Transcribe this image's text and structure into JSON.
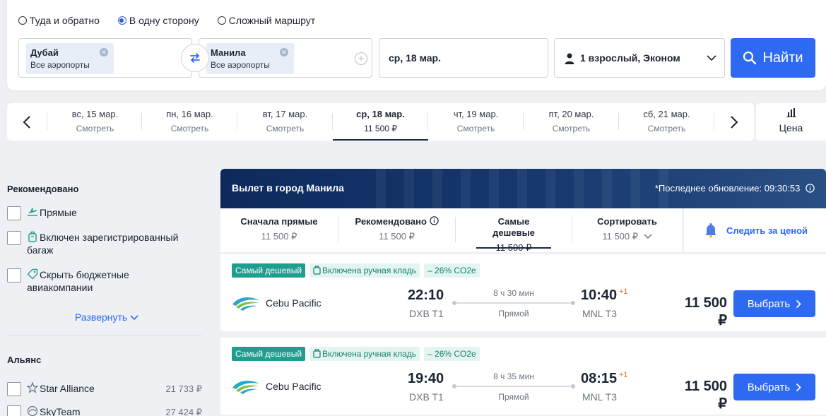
{
  "search": {
    "trip_types": [
      {
        "label": "Туда и обратно",
        "selected": false
      },
      {
        "label": "В одну сторону",
        "selected": true
      },
      {
        "label": "Сложный маршрут",
        "selected": false
      }
    ],
    "from": {
      "city": "Дубай",
      "sub": "Все аэропорты"
    },
    "to": {
      "city": "Манила",
      "sub": "Все аэропорты"
    },
    "date": "ср, 18 мар.",
    "passengers": "1 взрослый, Эконом",
    "button": "Найти"
  },
  "date_strip": {
    "days": [
      {
        "date": "вс, 15 мар.",
        "price": "Смотреть",
        "selected": false
      },
      {
        "date": "пн, 16 мар.",
        "price": "Смотреть",
        "selected": false
      },
      {
        "date": "вт, 17 мар.",
        "price": "Смотреть",
        "selected": false
      },
      {
        "date": "ср, 18 мар.",
        "price": "11 500 ₽",
        "selected": true
      },
      {
        "date": "чт, 19 мар.",
        "price": "Смотреть",
        "selected": false
      },
      {
        "date": "пт, 20 мар.",
        "price": "Смотреть",
        "selected": false
      },
      {
        "date": "сб, 21 мар.",
        "price": "Смотреть",
        "selected": false
      }
    ],
    "price_calendar": "Цена"
  },
  "filters": {
    "recommended_title": "Рекомендовано",
    "recommended": [
      {
        "label": "Прямые",
        "icon": "plane-takeoff-icon"
      },
      {
        "label": "Включен зарегистрированный багаж",
        "icon": "luggage-icon"
      },
      {
        "label": "Скрыть бюджетные авиакомпании",
        "icon": "tag-icon"
      }
    ],
    "expand": "Развернуть",
    "alliance_title": "Альянс",
    "alliances": [
      {
        "label": "Star Alliance",
        "price": "21 733 ₽"
      },
      {
        "label": "SkyTeam",
        "price": "27 424 ₽"
      }
    ]
  },
  "results": {
    "title": "Вылет в город Манила",
    "update": "*Последнее обновление: 09:30:53",
    "sort_tabs": [
      {
        "label": "Сначала прямые",
        "value": "11 500 ₽",
        "selected": false
      },
      {
        "label": "Рекомендовано",
        "value": "11 500 ₽",
        "selected": false
      },
      {
        "label": "Самые дешевые",
        "value": "11 500 ₽",
        "selected": true
      },
      {
        "label": "Сортировать",
        "value": "11 500 ₽",
        "selected": false
      }
    ],
    "watch_price": "Следить за ценой",
    "flights": [
      {
        "badges": [
          "Самый дешевый",
          "Включена ручная кладь",
          "– 26% CO2e"
        ],
        "airline": "Cebu Pacific",
        "dep_time": "22:10",
        "dep_airport": "DXB T1",
        "duration": "8 ч 30 мин",
        "stops": "Прямой",
        "arr_time": "10:40",
        "arr_plus": "+1",
        "arr_airport": "MNL T3",
        "price": "11 500 ₽",
        "button": "Выбрать"
      },
      {
        "badges": [
          "Самый дешевый",
          "Включена ручная кладь",
          "– 26% CO2e"
        ],
        "airline": "Cebu Pacific",
        "dep_time": "19:40",
        "dep_airport": "DXB T1",
        "duration": "8 ч 35 мин",
        "stops": "Прямой",
        "arr_time": "08:15",
        "arr_plus": "+1",
        "arr_airport": "MNL T3",
        "price": "11 500 ₽",
        "button": "Выбрать"
      }
    ]
  },
  "colors": {
    "accent": "#2d6af1",
    "header_dark": "#0e2a5c",
    "badge_green": "#1f9e8f"
  }
}
